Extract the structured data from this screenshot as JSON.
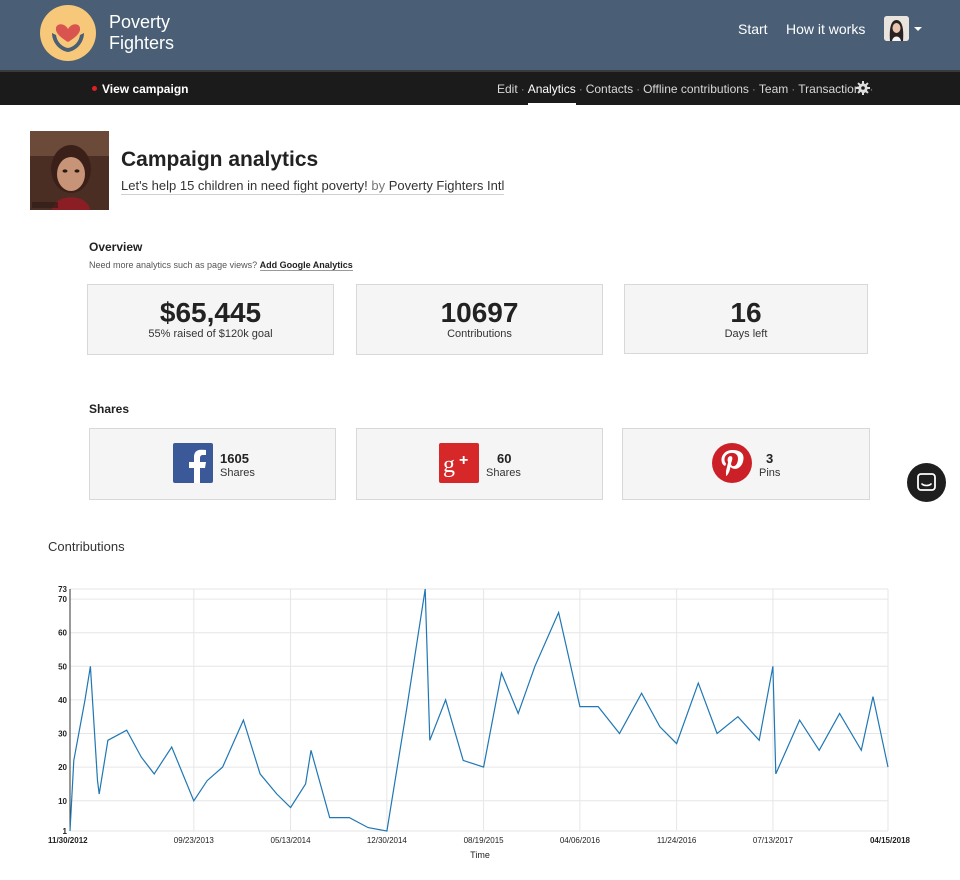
{
  "header": {
    "brand_line1": "Poverty",
    "brand_line2": "Fighters",
    "nav": [
      "Start",
      "How it works"
    ]
  },
  "subnav": {
    "view_campaign": "View campaign",
    "items": [
      "Edit",
      "Analytics",
      "Contacts",
      "Offline contributions",
      "Team",
      "Transactions"
    ],
    "active": "Analytics",
    "separator": "·"
  },
  "campaign": {
    "title": "Campaign analytics",
    "tagline": "Let's help 15 children in need fight poverty!",
    "by": "by",
    "organizer": "Poverty Fighters Intl"
  },
  "overview": {
    "heading": "Overview",
    "note": "Need more analytics such as page views?",
    "note_link": "Add Google Analytics",
    "stats": [
      {
        "value": "$65,445",
        "label": "55% raised of $120k goal"
      },
      {
        "value": "10697",
        "label": "Contributions"
      },
      {
        "value": "16",
        "label": "Days left"
      }
    ]
  },
  "shares": {
    "heading": "Shares",
    "items": [
      {
        "network": "facebook",
        "icon": "facebook-icon",
        "count": "1605",
        "label": "Shares",
        "color": "#3b5998"
      },
      {
        "network": "google-plus",
        "icon": "google-plus-icon",
        "count": "60",
        "label": "Shares",
        "color": "#d62828"
      },
      {
        "network": "pinterest",
        "icon": "pinterest-icon",
        "count": "3",
        "label": "Pins",
        "color": "#cb2027"
      }
    ]
  },
  "contributions_title": "Contributions",
  "chart_data": {
    "type": "line",
    "title": "",
    "xlabel": "Time",
    "ylabel": "",
    "ylim": [
      1,
      73
    ],
    "y_ticks": [
      "1",
      "10",
      "20",
      "30",
      "40",
      "50",
      "60",
      "70",
      "73"
    ],
    "x_ticks": [
      "11/30/2012",
      "09/23/2013",
      "05/13/2014",
      "12/30/2014",
      "08/19/2015",
      "04/06/2016",
      "11/24/2016",
      "07/13/2017",
      "04/15/2018"
    ],
    "x_range": [
      "11/30/2012",
      "04/15/2018"
    ],
    "grid": true,
    "line_color": "#1f77b4",
    "series": [
      {
        "x": [
          "11/30/2012",
          "12/09/2012",
          "01/05/2013",
          "01/18/2013",
          "02/04/2013",
          "02/08/2013",
          "03/01/2013",
          "04/15/2013",
          "05/20/2013",
          "06/20/2013",
          "08/01/2013",
          "09/23/2013",
          "10/25/2013",
          "12/01/2013",
          "01/20/2014",
          "03/01/2014",
          "04/10/2014",
          "05/13/2014",
          "06/18/2014",
          "07/01/2014",
          "08/15/2014",
          "10/01/2014",
          "11/15/2014",
          "12/30/2014",
          "02/15/2015",
          "04/01/2015",
          "04/12/2015",
          "05/20/2015",
          "07/01/2015",
          "08/19/2015",
          "10/01/2015",
          "11/10/2015",
          "12/20/2015",
          "02/15/2016",
          "04/06/2016",
          "05/20/2016",
          "07/10/2016",
          "09/01/2016",
          "10/15/2016",
          "11/24/2016",
          "01/15/2017",
          "03/01/2017",
          "04/20/2017",
          "06/10/2017",
          "07/13/2017",
          "07/20/2017",
          "09/15/2017",
          "11/01/2017",
          "12/20/2017",
          "02/10/2018",
          "03/10/2018",
          "04/15/2018"
        ],
        "values": [
          1,
          22,
          40,
          50,
          16,
          12,
          28,
          31,
          23,
          18,
          26,
          10,
          16,
          20,
          34,
          18,
          12,
          8,
          15,
          25,
          5,
          5,
          2,
          1,
          37,
          73,
          28,
          40,
          22,
          20,
          48,
          36,
          50,
          66,
          38,
          38,
          30,
          42,
          32,
          27,
          45,
          30,
          35,
          28,
          50,
          18,
          34,
          25,
          36,
          25,
          41,
          20
        ]
      }
    ]
  }
}
